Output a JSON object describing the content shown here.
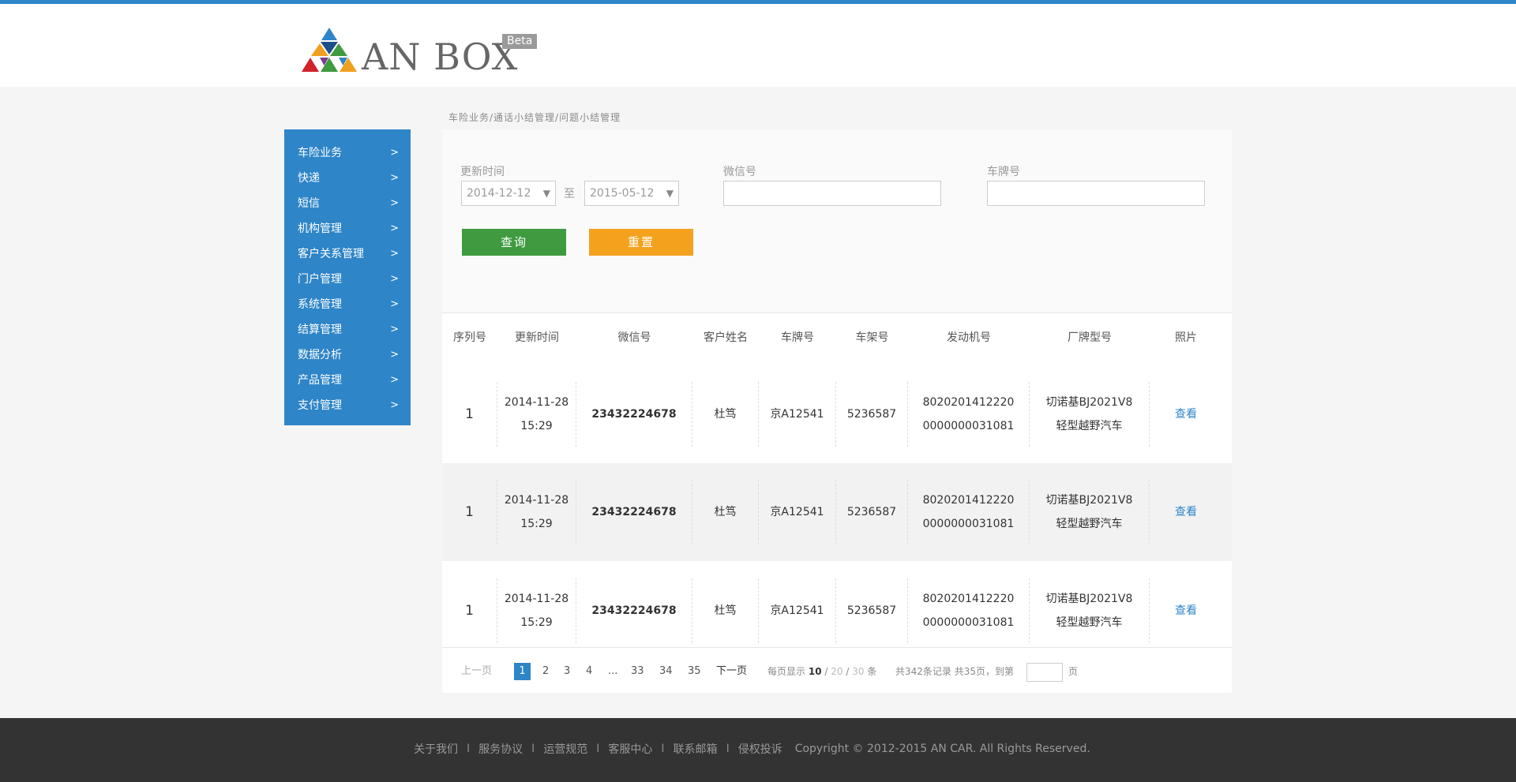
{
  "brand": {
    "name": "AN BOX",
    "badge": "Beta"
  },
  "sidebar": {
    "items": [
      {
        "label": "车险业务"
      },
      {
        "label": "快递"
      },
      {
        "label": "短信"
      },
      {
        "label": "机构管理"
      },
      {
        "label": "客户关系管理"
      },
      {
        "label": "门户管理"
      },
      {
        "label": "系统管理"
      },
      {
        "label": "结算管理"
      },
      {
        "label": "数据分析"
      },
      {
        "label": "产品管理"
      },
      {
        "label": "支付管理"
      }
    ],
    "arrow": ">"
  },
  "breadcrumb": "车险业务/通话小结管理/问题小结管理",
  "filter": {
    "update_time_label": "更新时间",
    "start_date": "2014-12-12",
    "end_date": "2015-05-12",
    "to_label": "至",
    "wechat_label": "微信号",
    "plate_label": "车牌号",
    "query_button": "查询",
    "reset_button": "重置"
  },
  "table": {
    "headers": [
      "序列号",
      "更新时间",
      "微信号",
      "客户姓名",
      "车牌号",
      "车架号",
      "发动机号",
      "厂牌型号",
      "照片"
    ],
    "rows": [
      {
        "idx": "1",
        "date": "2014-11-28",
        "time": "15:29",
        "wechat": "23432224678",
        "name": "杜笃",
        "plate": "京A12541",
        "vin": "5236587",
        "engine1": "8020201412220",
        "engine2": "0000000031081",
        "model1": "切诺基BJ2021V8",
        "model2": "轻型越野汽车",
        "photo": "查看"
      },
      {
        "idx": "1",
        "date": "2014-11-28",
        "time": "15:29",
        "wechat": "23432224678",
        "name": "杜笃",
        "plate": "京A12541",
        "vin": "5236587",
        "engine1": "8020201412220",
        "engine2": "0000000031081",
        "model1": "切诺基BJ2021V8",
        "model2": "轻型越野汽车",
        "photo": "查看"
      },
      {
        "idx": "1",
        "date": "2014-11-28",
        "time": "15:29",
        "wechat": "23432224678",
        "name": "杜笃",
        "plate": "京A12541",
        "vin": "5236587",
        "engine1": "8020201412220",
        "engine2": "0000000031081",
        "model1": "切诺基BJ2021V8",
        "model2": "轻型越野汽车",
        "photo": "查看"
      }
    ]
  },
  "pagination": {
    "prev": "上一页",
    "pages": [
      "1",
      "2",
      "3",
      "4",
      "...",
      "33",
      "34",
      "35"
    ],
    "current": "1",
    "next": "下一页",
    "per_page_label": "每页显示",
    "per_page_options": [
      "10",
      "20",
      "30"
    ],
    "per_page_unit": "条",
    "summary": "共342条记录 共35页，到第",
    "page_unit": "页"
  },
  "footer": {
    "links": [
      "关于我们",
      "服务协议",
      "运营规范",
      "客服中心",
      "联系邮箱",
      "侵权投诉"
    ],
    "separator": "I",
    "copyright": "Copyright © 2012-2015 AN CAR.  All Rights Reserved."
  },
  "colors": {
    "primary": "#2e85c8",
    "query": "#3f9a40",
    "reset": "#f4a21e",
    "footer": "#333333"
  }
}
